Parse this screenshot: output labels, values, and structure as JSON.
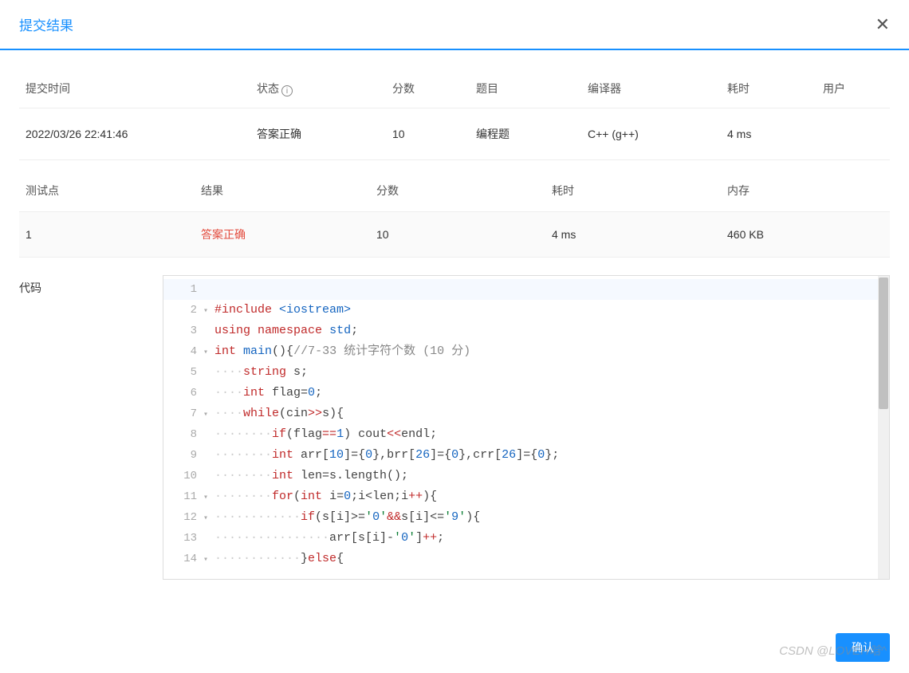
{
  "modal": {
    "title": "提交结果",
    "close_glyph": "✕",
    "confirm_label": "确认"
  },
  "table1": {
    "headers": {
      "time": "提交时间",
      "status": "状态",
      "score": "分数",
      "problem": "题目",
      "compiler": "编译器",
      "runtime": "耗时",
      "user": "用户"
    },
    "row": {
      "time": "2022/03/26 22:41:46",
      "status": "答案正确",
      "score": "10",
      "problem": "编程题",
      "compiler": "C++ (g++)",
      "runtime": "4 ms",
      "user": ""
    }
  },
  "table2": {
    "headers": {
      "testcase": "测试点",
      "result": "结果",
      "score": "分数",
      "runtime": "耗时",
      "memory": "内存"
    },
    "row": {
      "testcase": "1",
      "result": "答案正确",
      "score": "10",
      "runtime": "4 ms",
      "memory": "460 KB"
    }
  },
  "code": {
    "label": "代码",
    "lines": [
      "",
      "#include <iostream>",
      "using namespace std;",
      "int main(){//7-33 统计字符个数 (10 分)",
      "    string s;",
      "    int flag=0;",
      "    while(cin>>s){",
      "        if(flag==1) cout<<endl;",
      "        int arr[10]={0},brr[26]={0},crr[26]={0};",
      "        int len=s.length();",
      "        for(int i=0;i<len;i++){",
      "            if(s[i]>='0'&&s[i]<='9'){",
      "                arr[s[i]-'0']++;",
      "            }else{"
    ]
  },
  "watermark": "CSDN @LOVEH晗^"
}
